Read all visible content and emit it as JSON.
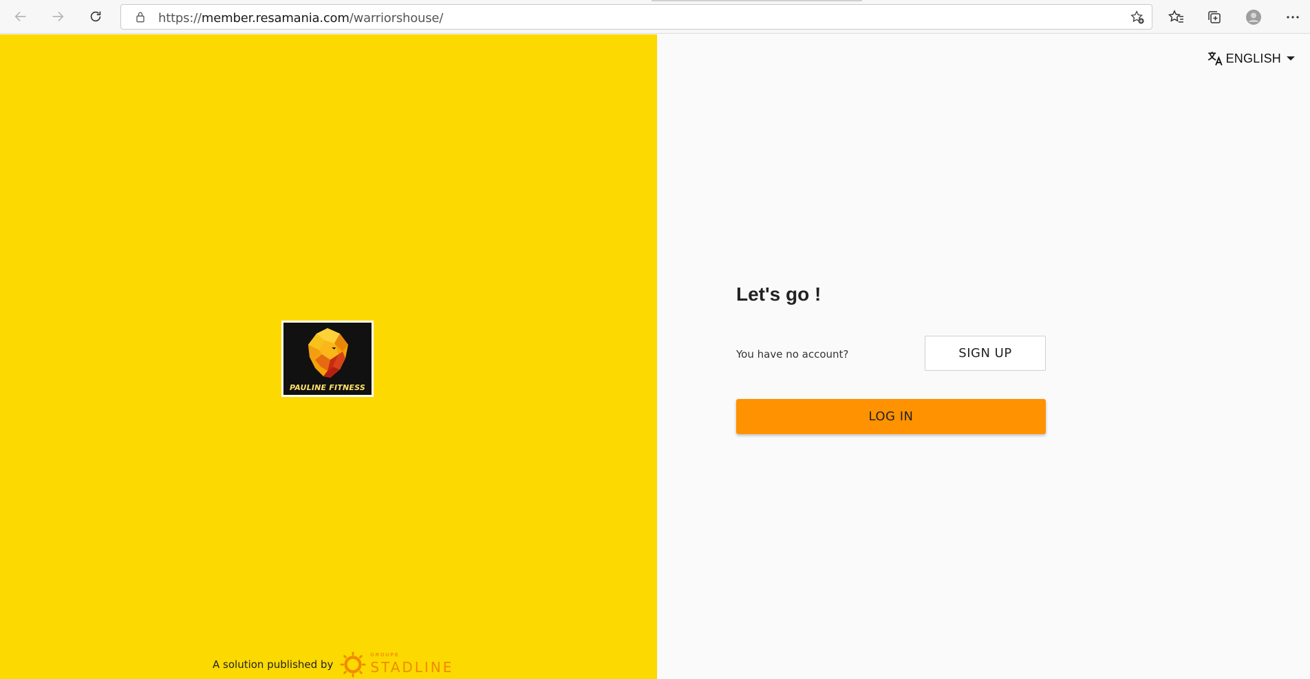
{
  "browser": {
    "url_scheme": "https://",
    "url_host": "member.resamania.com",
    "url_path": "/warriorshouse/"
  },
  "branding": {
    "gym_name": "PAULINE FITNESS",
    "publisher_text": "A solution published by",
    "publisher_group": "GROUPE",
    "publisher_name": "STADLINE"
  },
  "language": {
    "selected": "ENGLISH"
  },
  "auth": {
    "heading": "Let's go !",
    "no_account_text": "You have no account?",
    "signup_label": "SIGN UP",
    "login_label": "LOG IN"
  },
  "colors": {
    "left_panel": "#fcd900",
    "login_button": "#ff9200",
    "publisher_brand": "#f08a00"
  }
}
